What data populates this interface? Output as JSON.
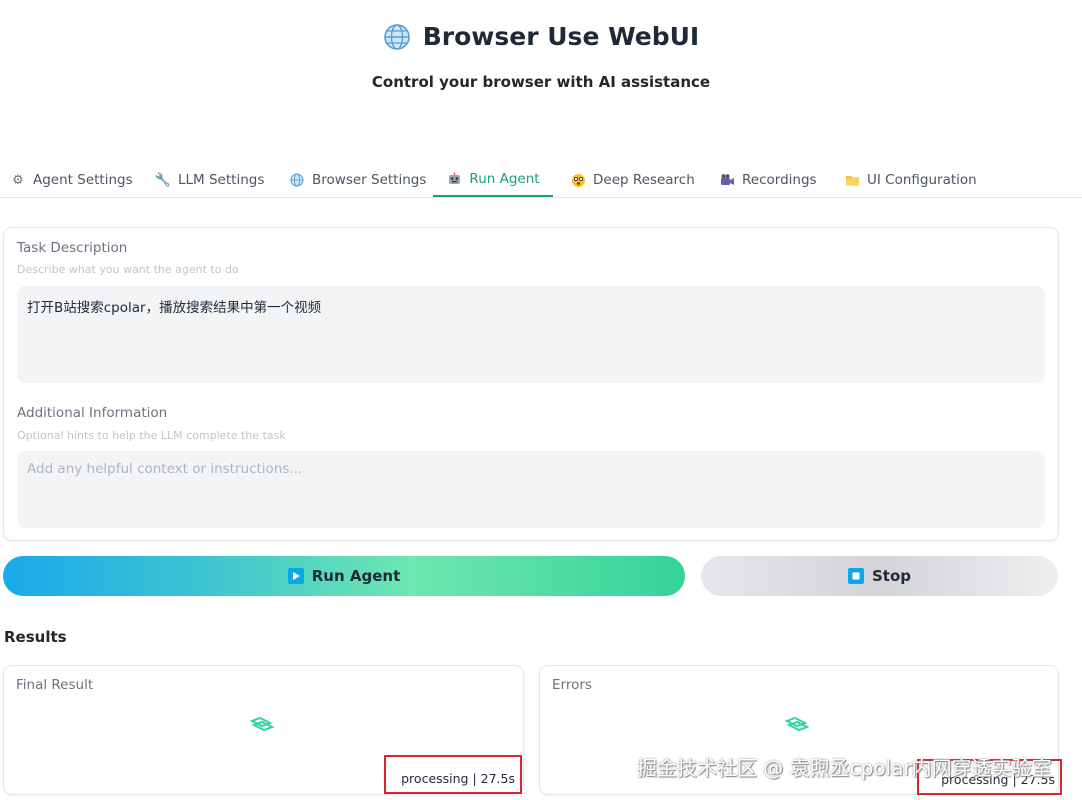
{
  "header": {
    "title": "Browser Use WebUI",
    "subtitle": "Control your browser with AI assistance",
    "title_icon": "globe-icon"
  },
  "tabs": [
    {
      "label": "Agent Settings",
      "icon": "gear-icon"
    },
    {
      "label": "LLM Settings",
      "icon": "wrench-icon"
    },
    {
      "label": "Browser Settings",
      "icon": "globe-icon"
    },
    {
      "label": "Run Agent",
      "icon": "robot-icon",
      "active": true
    },
    {
      "label": "Deep Research",
      "icon": "face-icon"
    },
    {
      "label": "Recordings",
      "icon": "camera-icon"
    },
    {
      "label": "UI Configuration",
      "icon": "folder-icon"
    }
  ],
  "task": {
    "label": "Task Description",
    "hint": "Describe what you want the agent to do",
    "value": "打开B站搜索cpolar，播放搜索结果中第一个视频"
  },
  "additional": {
    "label": "Additional Information",
    "hint": "Optional hints to help the LLM complete the task",
    "placeholder": "Add any helpful context or instructions..."
  },
  "buttons": {
    "run_label": "Run Agent",
    "stop_label": "Stop"
  },
  "results": {
    "heading": "Results",
    "final_label": "Final Result",
    "errors_label": "Errors",
    "final_status": "processing | 27.5s",
    "errors_status": "processing | 27.5s"
  },
  "watermark": "掘金技术社区 @ 袁煦丞cpolar内网穿透实验室",
  "colors": {
    "accent": "#16a37a",
    "highlight_box": "#d9272e"
  }
}
